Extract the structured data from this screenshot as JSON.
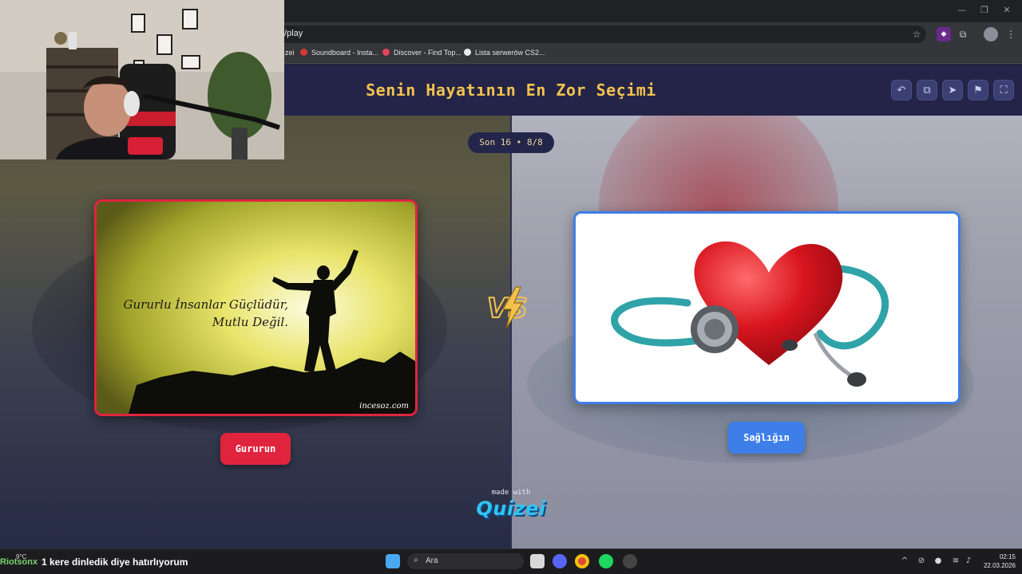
{
  "browser": {
    "url": "/play",
    "bookmarks": [
      {
        "label": "zei",
        "color": "#7a7a7a"
      },
      {
        "label": "Soundboard - Insta...",
        "color": "#d23a3a"
      },
      {
        "label": "Discover - Find Top...",
        "color": "#e2445c"
      },
      {
        "label": "Lista serwerów CS2...",
        "color": "#e8eaed"
      }
    ],
    "icons": [
      "star-icon",
      "extension-icon",
      "puzzle-icon",
      "profile-avatar",
      "menu-icon"
    ]
  },
  "quiz": {
    "title": "Senin Hayatının En Zor Seçimi",
    "round_label": "Son 16 • 8/8",
    "header_buttons": [
      "undo-icon",
      "share-icon",
      "send-icon",
      "flag-icon",
      "fullscreen-icon"
    ],
    "left_option": {
      "label": "Gururun",
      "image_text_line1": "Gururlu İnsanlar Güçlüdür,",
      "image_text_line2": "Mutlu Değil.",
      "watermark": "incesoz.com",
      "accent": "#e0243e"
    },
    "right_option": {
      "label": "Sağlığın",
      "accent": "#3e7ee8"
    },
    "vs_label": "VS",
    "made_with": "made with",
    "brand": "Quizei"
  },
  "taskbar": {
    "weather_temp": "9°C",
    "overlay_user": "Riotsonx",
    "overlay_message": "1 kere dinledik diye hatırlıyorum",
    "search_placeholder": "Ara",
    "time": "02:15",
    "date": "22.03.2026"
  }
}
